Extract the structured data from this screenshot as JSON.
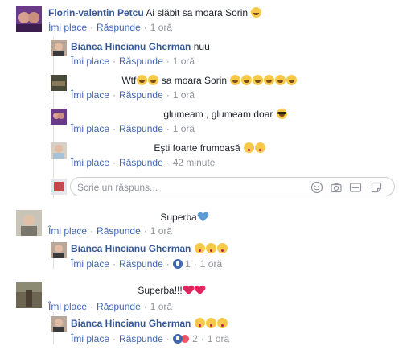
{
  "comments": [
    {
      "name": "Florin-valentin Petcu",
      "text": "Ai slăbit sa moara Sorin",
      "like": "Îmi place",
      "reply": "Răspunde",
      "time": "1 oră"
    },
    {
      "name": "Bianca Hincianu Gherman",
      "text": "nuu",
      "like": "Îmi place",
      "reply": "Răspunde",
      "time": "1 oră"
    },
    {
      "name": "",
      "text": "Wtf",
      "text2": "sa moara Sorin",
      "like": "Îmi place",
      "reply": "Răspunde",
      "time": "1 oră"
    },
    {
      "name": "",
      "text": "glumeam , glumeam doar",
      "like": "Îmi place",
      "reply": "Răspunde",
      "time": "1 oră"
    },
    {
      "name": "",
      "text": "Ești foarte frumoasă",
      "like": "Îmi place",
      "reply": "Răspunde",
      "time": "42 minute"
    },
    {
      "name": "",
      "text": "Superba",
      "like": "Îmi place",
      "reply": "Răspunde",
      "time": "1 oră"
    },
    {
      "name": "Bianca Hincianu Gherman",
      "text": "",
      "like": "Îmi place",
      "reply": "Răspunde",
      "reactions": "1",
      "time": "1 oră"
    },
    {
      "name": "",
      "text": "Superba!!!",
      "like": "Îmi place",
      "reply": "Răspunde",
      "time": "1 oră"
    },
    {
      "name": "Bianca Hincianu Gherman",
      "text": "",
      "like": "Îmi place",
      "reply": "Răspunde",
      "reactions": "2",
      "time": "1 oră"
    }
  ],
  "reply_box": {
    "placeholder": "Scrie un răspuns..."
  },
  "icons": [
    "emoji-icon",
    "camera-icon",
    "gif-icon",
    "sticker-icon"
  ],
  "colors": {
    "link": "#4267b2",
    "name": "#365899",
    "meta": "#90949c",
    "border": "#dddfe2"
  }
}
